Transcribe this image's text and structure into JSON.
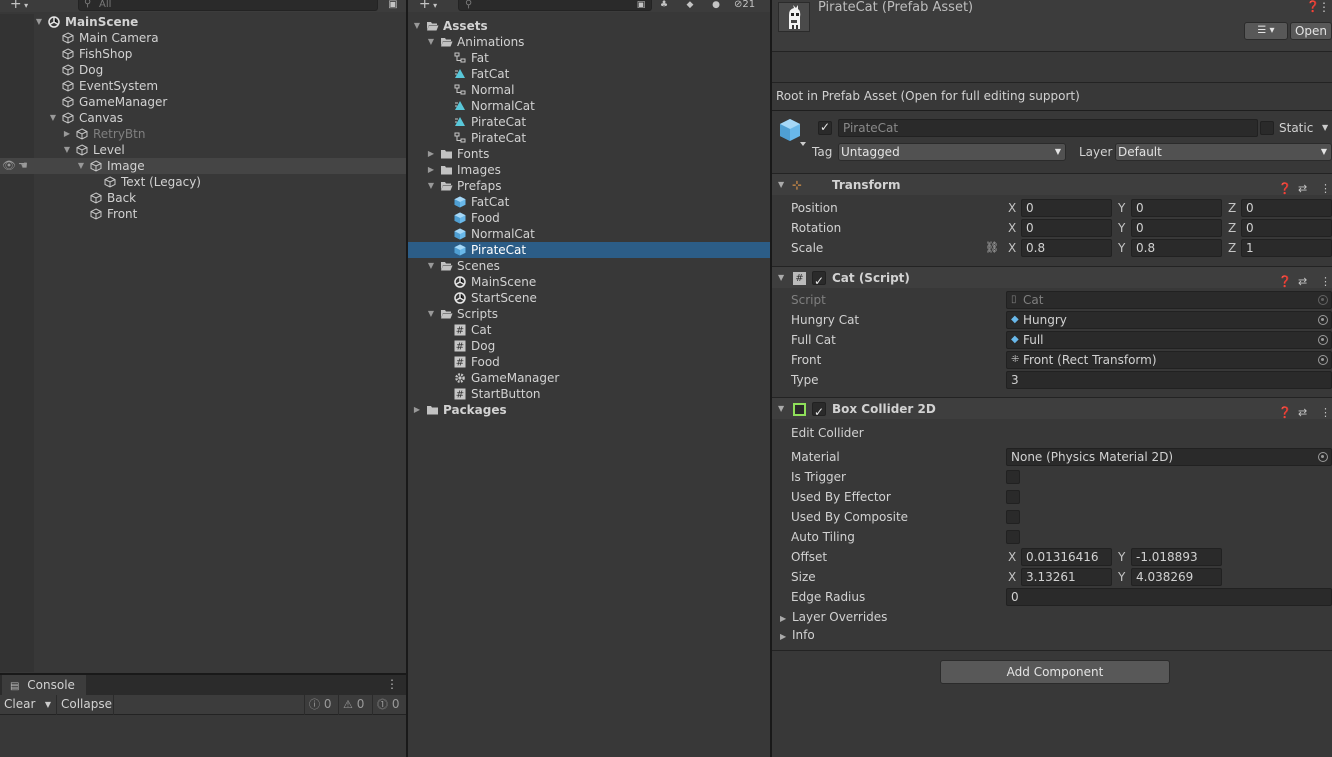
{
  "hierarchy": {
    "search_placeholder": "All",
    "scene": "MainScene",
    "items": [
      {
        "label": "Main Camera"
      },
      {
        "label": "FishShop"
      },
      {
        "label": "Dog"
      },
      {
        "label": "EventSystem"
      },
      {
        "label": "GameManager"
      },
      {
        "label": "Canvas"
      },
      {
        "label": "RetryBtn"
      },
      {
        "label": "Level"
      },
      {
        "label": "Image"
      },
      {
        "label": "Text (Legacy)"
      },
      {
        "label": "Back"
      },
      {
        "label": "Front"
      }
    ]
  },
  "console": {
    "tab_label": "Console",
    "clear_label": "Clear",
    "collapse_label": "Collapse",
    "log_count": "0",
    "warn_count": "0",
    "error_count": "0"
  },
  "project": {
    "hidden_count": "21",
    "items": [
      {
        "label": "Assets"
      },
      {
        "label": "Animations"
      },
      {
        "label": "Fat"
      },
      {
        "label": "FatCat"
      },
      {
        "label": "Normal"
      },
      {
        "label": "NormalCat"
      },
      {
        "label": "PirateCat"
      },
      {
        "label": "PirateCat"
      },
      {
        "label": "Fonts"
      },
      {
        "label": "Images"
      },
      {
        "label": "Prefaps"
      },
      {
        "label": "FatCat"
      },
      {
        "label": "Food"
      },
      {
        "label": "NormalCat"
      },
      {
        "label": "PirateCat"
      },
      {
        "label": "Scenes"
      },
      {
        "label": "MainScene"
      },
      {
        "label": "StartScene"
      },
      {
        "label": "Scripts"
      },
      {
        "label": "Cat"
      },
      {
        "label": "Dog"
      },
      {
        "label": "Food"
      },
      {
        "label": "GameManager"
      },
      {
        "label": "StartButton"
      },
      {
        "label": "Packages"
      }
    ]
  },
  "inspector": {
    "title": "PirateCat (Prefab Asset)",
    "open_label": "Open",
    "root_note": "Root in Prefab Asset (Open for full editing support)",
    "object_name": "PirateCat",
    "static_label": "Static",
    "tag_label": "Tag",
    "tag_value": "Untagged",
    "layer_label": "Layer",
    "layer_value": "Default",
    "transform": {
      "title": "Transform",
      "position_label": "Position",
      "rotation_label": "Rotation",
      "scale_label": "Scale",
      "axis_x": "X",
      "axis_y": "Y",
      "axis_z": "Z",
      "position": [
        "0",
        "0",
        "0"
      ],
      "rotation": [
        "0",
        "0",
        "0"
      ],
      "scale": [
        "0.8",
        "0.8",
        "1"
      ]
    },
    "cat_script": {
      "title": "Cat (Script)",
      "script_label": "Script",
      "script_value": "Cat",
      "hungry_label": "Hungry Cat",
      "hungry_value": "Hungry",
      "full_label": "Full Cat",
      "full_value": "Full",
      "front_label": "Front",
      "front_value": "Front (Rect Transform)",
      "type_label": "Type",
      "type_value": "3"
    },
    "box_collider": {
      "title": "Box Collider 2D",
      "edit_collider_label": "Edit Collider",
      "material_label": "Material",
      "material_value": "None (Physics Material 2D)",
      "is_trigger_label": "Is Trigger",
      "used_by_effector_label": "Used By Effector",
      "used_by_composite_label": "Used By Composite",
      "auto_tiling_label": "Auto Tiling",
      "offset_label": "Offset",
      "offset_x": "0.01316416",
      "offset_y": "-1.018893",
      "size_label": "Size",
      "size_x": "3.13261",
      "size_y": "4.038269",
      "edge_radius_label": "Edge Radius",
      "edge_radius_value": "0",
      "layer_overrides_label": "Layer Overrides",
      "info_label": "Info"
    },
    "add_component_label": "Add Component"
  },
  "colors": {
    "selection": "#2c5d87",
    "prefab_blue": "#69b8ea",
    "panel_bg": "#383838"
  }
}
